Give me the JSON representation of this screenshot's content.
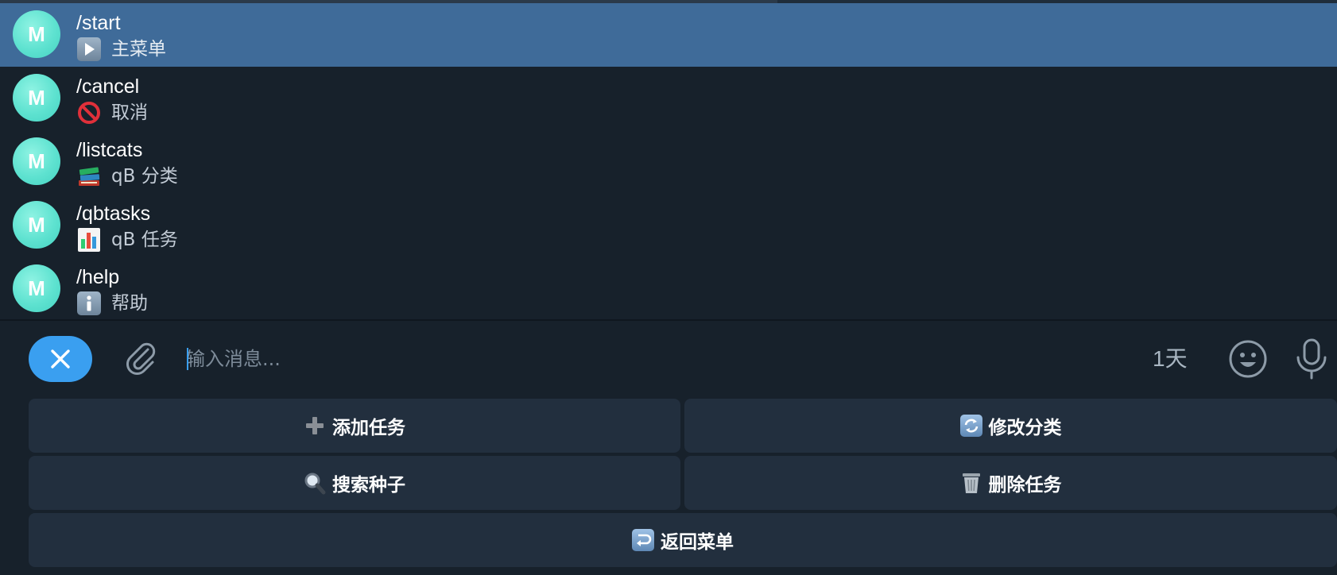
{
  "commands": [
    {
      "avatar": "M",
      "name": "/start",
      "icon": "play-button-icon",
      "description": "主菜单",
      "selected": true
    },
    {
      "avatar": "M",
      "name": "/cancel",
      "icon": "prohibited-icon",
      "description": "取消",
      "selected": false
    },
    {
      "avatar": "M",
      "name": "/listcats",
      "icon": "books-icon",
      "description": "qB 分类",
      "selected": false
    },
    {
      "avatar": "M",
      "name": "/qbtasks",
      "icon": "bar-chart-icon",
      "description": "qB 任务",
      "selected": false
    },
    {
      "avatar": "M",
      "name": "/help",
      "icon": "info-icon",
      "description": "帮助",
      "selected": false
    }
  ],
  "composer": {
    "close_icon": "close-icon",
    "attach_icon": "paperclip-icon",
    "input_value": "",
    "input_placeholder": "输入消息...",
    "timer_label": "1天",
    "emoji_icon": "smiley-icon",
    "mic_icon": "microphone-icon"
  },
  "keyboard": {
    "add_task": {
      "icon": "plus-icon",
      "label": "添加任务"
    },
    "change_category": {
      "icon": "refresh-arrows-icon",
      "label": "修改分类"
    },
    "search_torrent": {
      "icon": "magnifier-icon",
      "label": "搜索种子"
    },
    "delete_task": {
      "icon": "wastebasket-icon",
      "label": "删除任务"
    },
    "back_menu": {
      "icon": "return-arrow-icon",
      "label": "返回菜单"
    }
  },
  "colors": {
    "background": "#17212b",
    "selected_row": "#3f6b99",
    "accent": "#3a9ff0",
    "avatar": "#5ee2d0",
    "keyboard_button": "#222f3e"
  }
}
